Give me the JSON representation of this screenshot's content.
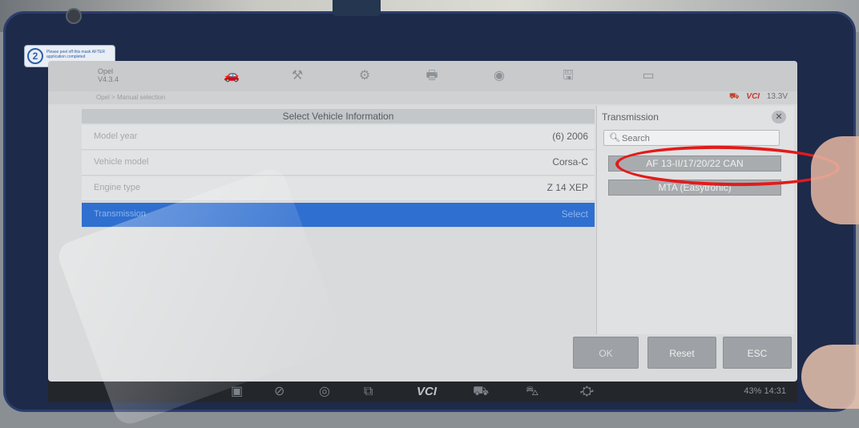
{
  "sticker": {
    "number": "2",
    "text": "Please peel off this mask AFTER application completed"
  },
  "toolbar": {
    "title_line1": "Opel",
    "title_line2": "V4.3.4"
  },
  "breadcrumb": "Opel > Manual selection",
  "status": {
    "vci_label": "VCI",
    "battery": "13.3V"
  },
  "main": {
    "header": "Select Vehicle Information",
    "rows": [
      {
        "label": "Model year",
        "value": "(6) 2006"
      },
      {
        "label": "Vehicle model",
        "value": "Corsa-C"
      },
      {
        "label": "Engine type",
        "value": "Z 14 XEP"
      },
      {
        "label": "Transmission",
        "value": "Select"
      }
    ]
  },
  "transmission_panel": {
    "title": "Transmission",
    "close_symbol": "✕",
    "search_placeholder": "Search",
    "options": [
      "AF 13-II/17/20/22 CAN",
      "MTA (Easytronic)"
    ]
  },
  "buttons": {
    "ok": "OK",
    "reset": "Reset",
    "esc": "ESC"
  },
  "navbar": {
    "vci_label": "VCI",
    "status_text": "43% 14:31"
  },
  "colors": {
    "selected_row": "#2f6fd0",
    "annotation": "#e21b1b",
    "active_tab_icon": "#3a7bd5"
  },
  "icons": [
    "car-icon",
    "wrench-icon",
    "gear-icon",
    "printer-icon",
    "help-icon",
    "save-icon",
    "message-icon"
  ]
}
